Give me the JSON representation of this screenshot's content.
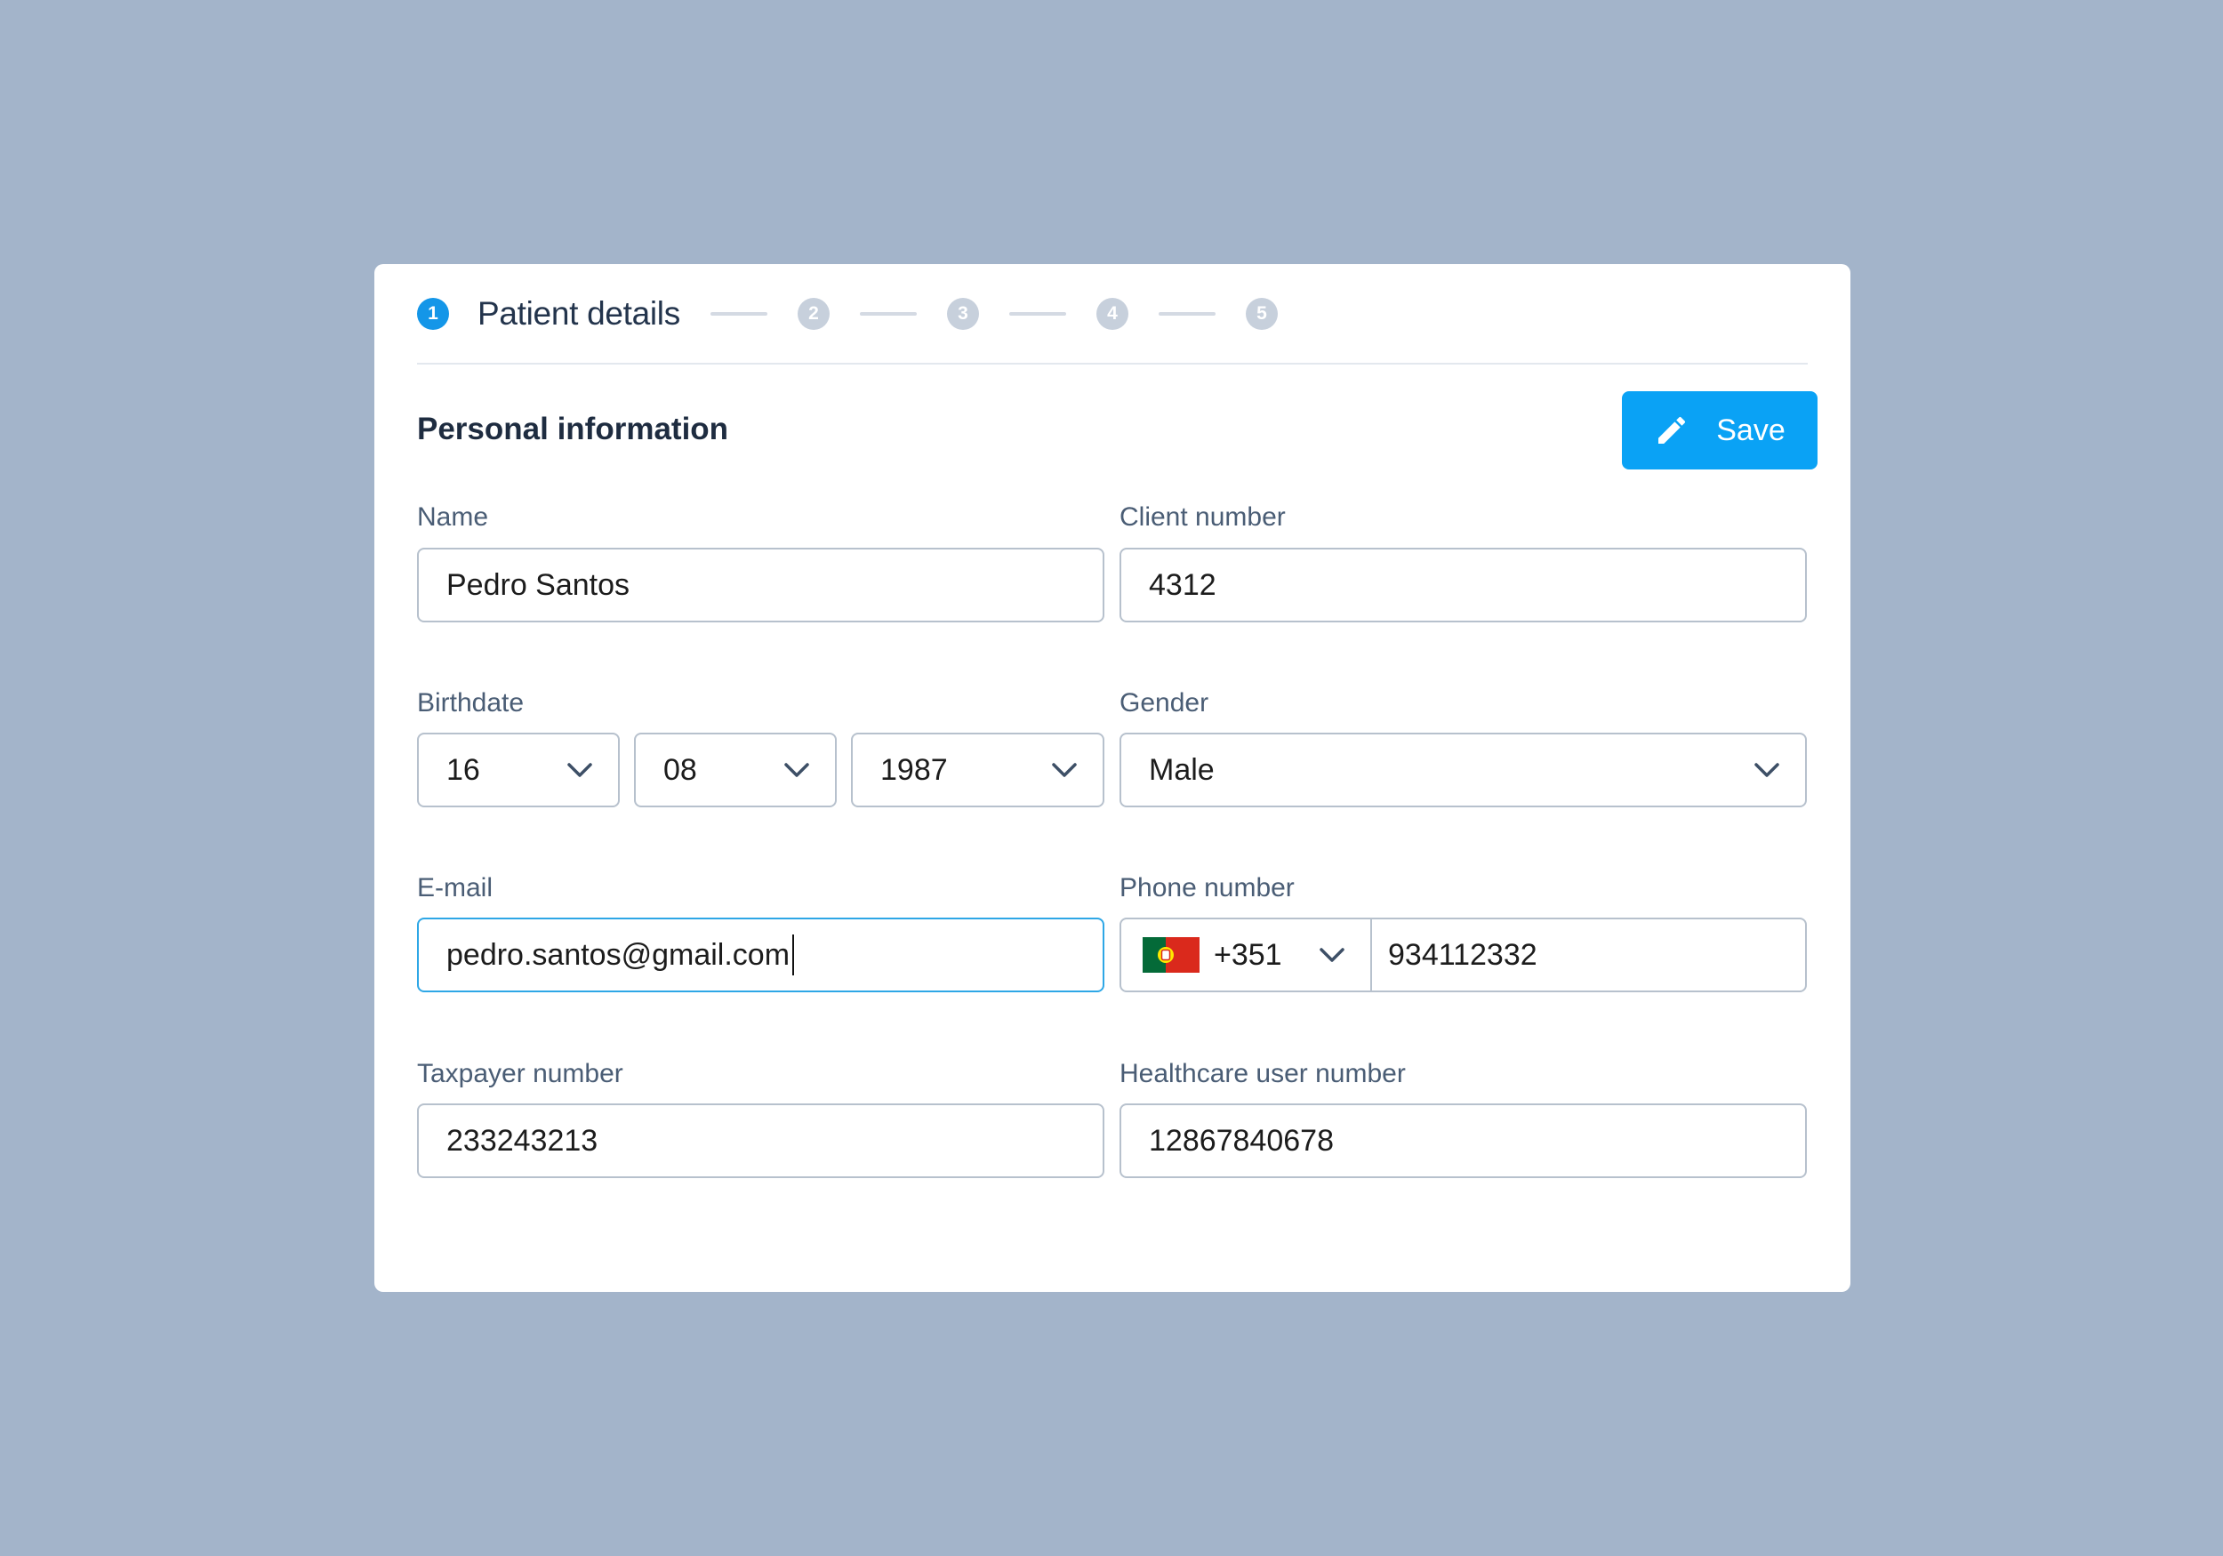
{
  "stepper": {
    "active_step": "1",
    "title": "Patient details",
    "steps": [
      "2",
      "3",
      "4",
      "5"
    ]
  },
  "section": {
    "title": "Personal information",
    "save_label": "Save"
  },
  "form": {
    "name": {
      "label": "Name",
      "value": "Pedro Santos"
    },
    "client_number": {
      "label": "Client number",
      "value": "4312"
    },
    "birthdate": {
      "label": "Birthdate",
      "day": "16",
      "month": "08",
      "year": "1987"
    },
    "gender": {
      "label": "Gender",
      "value": "Male"
    },
    "email": {
      "label": "E-mail",
      "value": "pedro.santos@gmail.com"
    },
    "phone": {
      "label": "Phone number",
      "country_code": "+351",
      "country_flag": "portugal-flag-icon",
      "number": "934112332"
    },
    "taxpayer": {
      "label": "Taxpayer number",
      "value": "233243213"
    },
    "healthcare": {
      "label": "Healthcare user number",
      "value": "12867840678"
    }
  },
  "colors": {
    "background": "#a3b4ca",
    "accent": "#0aa2f5",
    "step_active": "#1496e8",
    "step_inactive": "#c7d0dc",
    "focus_border": "#2ea7e6"
  }
}
